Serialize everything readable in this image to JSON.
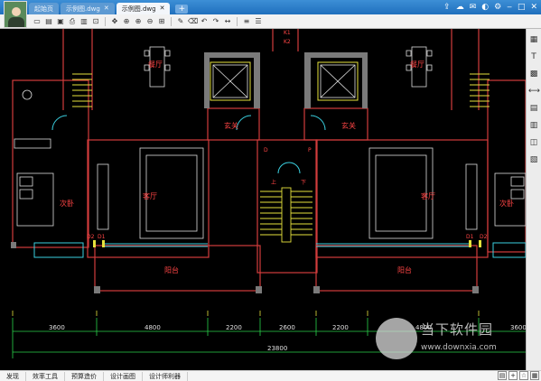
{
  "tabs": [
    {
      "label": "起始页",
      "closable": false
    },
    {
      "label": "示例图.dwg",
      "closable": true
    },
    {
      "label": "示例图.dwg",
      "closable": true
    }
  ],
  "newtab_label": "+",
  "canvas": {
    "rooms": {
      "dining_left": "餐厅",
      "dining_right": "餐厅",
      "foyer_left": "玄关",
      "foyer_right": "玄关",
      "living_left": "客厅",
      "living_right": "客厅",
      "bedroom_left": "次卧",
      "bedroom_right": "次卧",
      "balcony_left": "阳台",
      "balcony_right": "阳台"
    },
    "labels": {
      "k1": "K1",
      "k2": "K2",
      "d": "D",
      "p": "P",
      "up": "上",
      "down": "下",
      "d1": "D1",
      "d2": "D2"
    },
    "dimensions": [
      "3600",
      "4800",
      "2200",
      "2600",
      "2200",
      "4800",
      "3600"
    ],
    "total": "23800"
  },
  "watermark": {
    "text": "当下软件园",
    "url": "www.downxia.com"
  },
  "status": [
    "发现",
    "效率工具",
    "预算造价",
    "设计画图",
    "设计师利器"
  ]
}
